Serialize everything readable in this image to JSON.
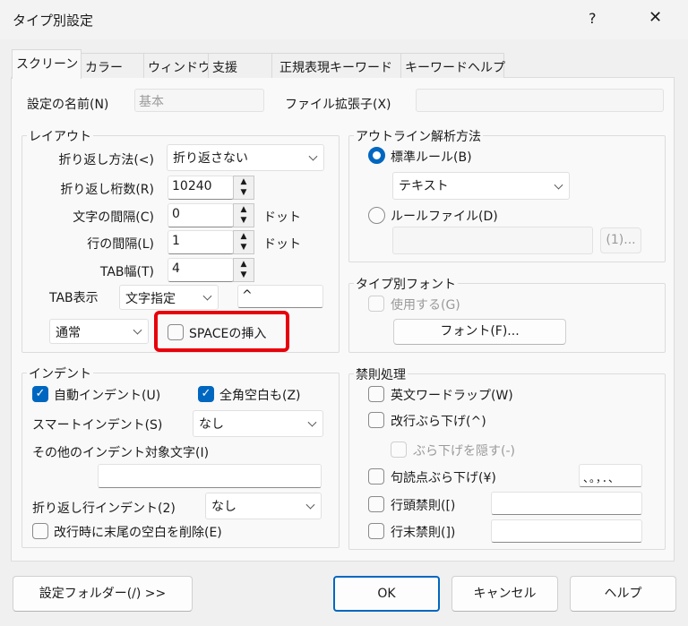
{
  "window": {
    "title": "タイプ別設定",
    "help": "?",
    "close": "✕"
  },
  "tabs": [
    "スクリーン",
    "カラー",
    "ウィンドウ",
    "支援",
    "正規表現キーワード",
    "キーワードヘルプ"
  ],
  "name": {
    "label": "設定の名前(N)",
    "value": "基本",
    "ext_label": "ファイル拡張子(X)",
    "ext_value": ""
  },
  "layout": {
    "title": "レイアウト",
    "wrap_method_label": "折り返し方法(<)",
    "wrap_method": "折り返さない",
    "wrap_cols_label": "折り返し桁数(R)",
    "wrap_cols": "10240",
    "char_space_label": "文字の間隔(C)",
    "char_space": "0",
    "line_space_label": "行の間隔(L)",
    "line_space": "1",
    "dot": "ドット",
    "tab_width_label": "TAB幅(T)",
    "tab_width": "4",
    "tab_display_label": "TAB表示",
    "tab_display": "文字指定",
    "tab_char": "^",
    "tab_style": "通常",
    "space_insert": "SPACEの挿入",
    "space_insert_checked": false,
    "highlight_color": "#e8000b"
  },
  "indent": {
    "title": "インデント",
    "auto": "自動インデント(U)",
    "auto_checked": true,
    "zenkaku": "全角空白も(Z)",
    "zenkaku_checked": true,
    "smart_label": "スマートインデント(S)",
    "smart": "なし",
    "other_label": "その他のインデント対象文字(I)",
    "other": "",
    "wrap_indent_label": "折り返し行インデント(2)",
    "wrap_indent": "なし",
    "trim": "改行時に末尾の空白を削除(E)",
    "trim_checked": false
  },
  "outline": {
    "title": "アウトライン解析方法",
    "standard": "標準ルール(B)",
    "standard_selected": true,
    "rule": "テキスト",
    "rulefile": "ルールファイル(D)",
    "rulefile_value": "",
    "browse": "(1)..."
  },
  "font": {
    "title": "タイプ別フォント",
    "use": "使用する(G)",
    "button": "フォント(F)..."
  },
  "kinsoku": {
    "title": "禁則処理",
    "wordwrap": "英文ワードラップ(W)",
    "kaigyo": "改行ぶら下げ(^)",
    "hide": "ぶら下げを隠す(-)",
    "kutoten": "句読点ぶら下げ(¥)",
    "kutoten_chars": "、。，．、",
    "head": "行頭禁則([)",
    "head_chars": "",
    "tail": "行末禁則(])",
    "tail_chars": ""
  },
  "buttons": {
    "folder": "設定フォルダー(/) >>",
    "ok": "OK",
    "cancel": "キャンセル",
    "help": "ヘルプ"
  },
  "colors": {
    "accent": "#0067c0"
  }
}
